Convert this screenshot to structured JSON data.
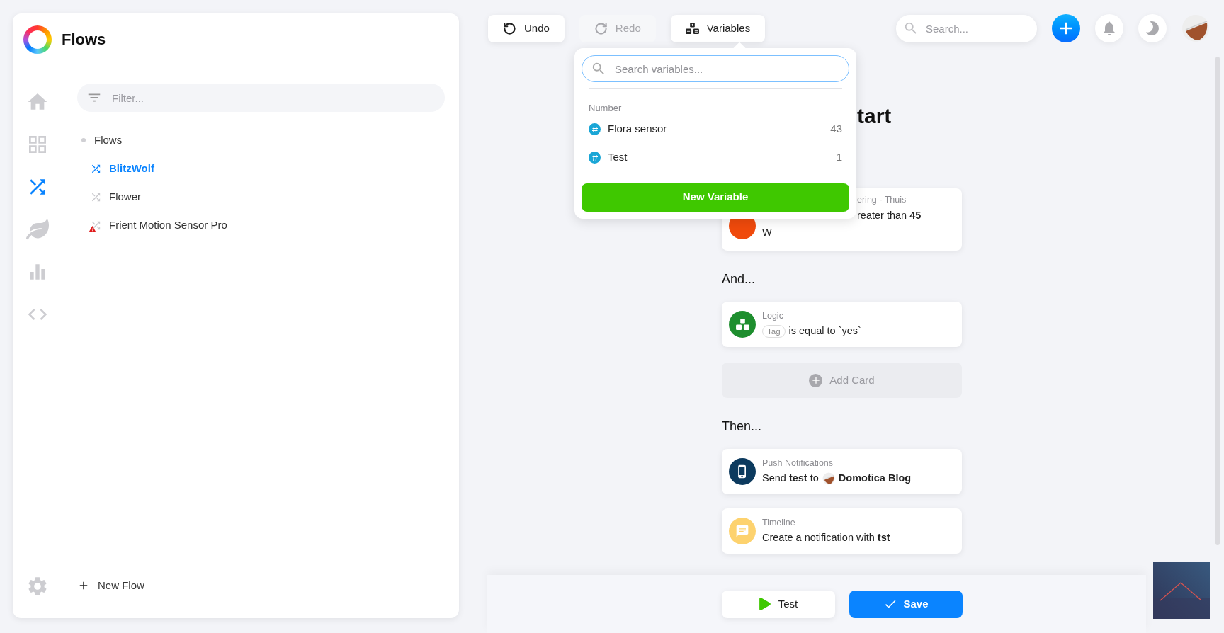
{
  "sidebar": {
    "title": "Flows",
    "nav": [
      {
        "selected": false
      },
      {
        "selected": false
      },
      {
        "selected": true
      },
      {
        "selected": false
      },
      {
        "selected": false
      },
      {
        "selected": false
      }
    ],
    "filter": {
      "placeholder": "Filter..."
    },
    "tree": {
      "label": "Flows",
      "children": [
        {
          "label": "BlitzWolf",
          "selected": true,
          "warning": false
        },
        {
          "label": "Flower",
          "selected": false,
          "warning": false
        },
        {
          "label": "Frient Motion Sensor Pro",
          "selected": false,
          "warning": true
        }
      ]
    },
    "new_flow": "New Flow"
  },
  "toolbar": {
    "buttons": [
      {
        "kind": "undo",
        "label": "Undo",
        "disabled": false
      },
      {
        "kind": "redo",
        "label": "Redo",
        "disabled": true
      },
      {
        "kind": "variables",
        "label": "Variables",
        "disabled": false
      }
    ],
    "search": {
      "placeholder": "Search..."
    }
  },
  "variables_popup": {
    "search": {
      "placeholder": "Search variables..."
    },
    "group": "Number",
    "items": [
      {
        "name": "Flora sensor",
        "value": "43"
      },
      {
        "name": "Test",
        "value": "1"
      }
    ],
    "button": "New Variable"
  },
  "flow": {
    "title": "tart",
    "sections": [
      {
        "cards": [
          {
            "kind": "trigger",
            "color": "#f04a0c",
            "app": "ering - Thuis",
            "text": "reater than **45**",
            "continuation": "W"
          }
        ]
      },
      {
        "heading": "And...",
        "cards": [
          {
            "kind": "logic",
            "color": "#1e8e2e",
            "app": "Logic",
            "tag": "Tag",
            "text": "is equal to `yes`"
          }
        ],
        "add_card": "Add Card"
      },
      {
        "heading": "Then...",
        "cards": [
          {
            "kind": "push",
            "color": "#0c3a5e",
            "app": "Push Notifications",
            "text": "Send **test** to",
            "target": "Domotica Blog"
          },
          {
            "kind": "timeline",
            "color": "#fdd26e",
            "app": "Timeline",
            "text": "Create a notification with **tst**"
          }
        ]
      }
    ]
  },
  "footer": {
    "test": "Test",
    "save": "Save"
  }
}
